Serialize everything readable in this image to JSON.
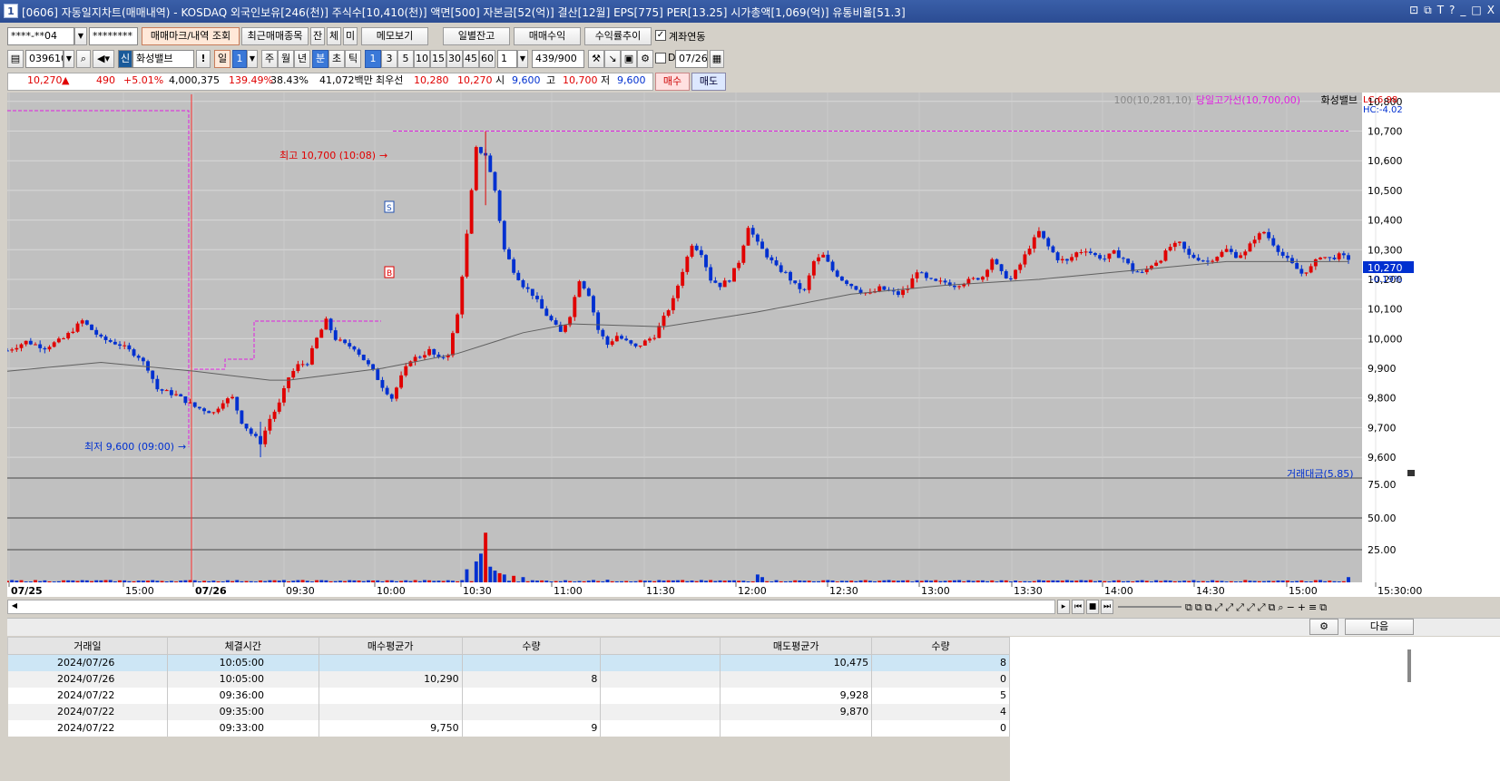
{
  "window": {
    "icon_label": "1",
    "title": "[0606] 자동일지차트(매매내역) - KOSDAQ 외국인보유[246(천)] 주식수[10,410(천)] 액면[500] 자본금[52(억)] 결산[12월] EPS[775] PER[13.25] 시가총액[1,069(억)] 유통비율[51.3]",
    "buttons": [
      "⊡",
      "⧉",
      "T",
      "?",
      "_",
      "□",
      "X"
    ]
  },
  "toolbar1": {
    "account": "****-**04",
    "password": "********",
    "trade_mark_btn": "매매마크/내역 조회",
    "recent_btn": "최근매매종목",
    "tab_jan": "잔",
    "tab_che": "체",
    "tab_mi": "미",
    "memo_btn": "메모보기",
    "daily_balance_btn": "일별잔고",
    "trade_profit_btn": "매매수익",
    "profit_trend_btn": "수익률추이",
    "account_link_label": "계좌연동"
  },
  "toolbar2": {
    "code": "039610",
    "credit": "신",
    "stock_name": "화성밸브",
    "periods": [
      "일",
      "1",
      "주",
      "월",
      "년",
      "분",
      "초",
      "틱"
    ],
    "minutes": [
      "1",
      "3",
      "5",
      "10",
      "15",
      "30",
      "45",
      "60"
    ],
    "unit_value": "1",
    "count": "439",
    "count_total": "/900",
    "d_label": "D",
    "date": "07/26"
  },
  "quote": {
    "price": "10,270",
    "change": "490",
    "change_pct": "+5.01%",
    "volume": "4,000,375",
    "vol_ratio": "139.49%",
    "turnover": "38.43%",
    "amount": "41,072백만",
    "best_label": "최우선",
    "ask": "10,280",
    "bid": "10,270",
    "open_label": "시",
    "open": "9,600",
    "high_label": "고",
    "high": "10,700",
    "low_label": "저",
    "low": "9,600",
    "buy_btn": "매수",
    "sell_btn": "매도"
  },
  "chart_labels": {
    "ma_legend": "100(10,281,10)",
    "high_line_legend": "당일고가선(10,700,00)",
    "stock_legend": "화성밸브",
    "lc": "LC:6.98",
    "hc": "HC:-4.02",
    "current_price": "10,270",
    "current_pct": "-0.19%",
    "max_label": "최고 10,700 (10:08)",
    "min_label": "최저 9,600 (09:00)",
    "volume_legend": "거래대금(5.85)",
    "mark_sell": "S",
    "mark_buy": "B"
  },
  "chart_data": {
    "type": "candlestick",
    "price_axis_ticks": [
      "10,800",
      "10,700",
      "10,600",
      "10,500",
      "10,400",
      "10,300",
      "10,200",
      "10,100",
      "10,000",
      "9,900",
      "9,800",
      "9,700",
      "9,600"
    ],
    "volume_axis_ticks": [
      "75.00",
      "50.00",
      "25.00"
    ],
    "time_axis_ticks": [
      "07/25",
      "15:00",
      "07/26",
      "09:30",
      "10:00",
      "10:30",
      "11:00",
      "11:30",
      "12:00",
      "12:30",
      "13:00",
      "13:30",
      "14:00",
      "14:30",
      "15:00",
      "15:30:00"
    ],
    "ylim": [
      9530,
      10830
    ],
    "high": 10700,
    "low": 9600,
    "close_path": [
      [
        0,
        9960
      ],
      [
        4,
        9990
      ],
      [
        8,
        9970
      ],
      [
        12,
        10000
      ],
      [
        16,
        10060
      ],
      [
        20,
        10000
      ],
      [
        24,
        9980
      ],
      [
        28,
        9940
      ],
      [
        30,
        9900
      ],
      [
        32,
        9830
      ],
      [
        36,
        9810
      ],
      [
        40,
        9770
      ],
      [
        44,
        9750
      ],
      [
        46,
        9790
      ],
      [
        48,
        9800
      ],
      [
        50,
        9720
      ],
      [
        52,
        9680
      ],
      [
        54,
        9650
      ],
      [
        56,
        9730
      ],
      [
        58,
        9780
      ],
      [
        60,
        9870
      ],
      [
        62,
        9910
      ],
      [
        64,
        9920
      ],
      [
        66,
        10000
      ],
      [
        68,
        10060
      ],
      [
        70,
        10000
      ],
      [
        72,
        9980
      ],
      [
        74,
        9970
      ],
      [
        76,
        9930
      ],
      [
        78,
        9890
      ],
      [
        80,
        9840
      ],
      [
        82,
        9800
      ],
      [
        84,
        9870
      ],
      [
        86,
        9930
      ],
      [
        88,
        9940
      ],
      [
        90,
        9960
      ],
      [
        92,
        9930
      ],
      [
        94,
        9950
      ],
      [
        96,
        10080
      ],
      [
        98,
        10350
      ],
      [
        100,
        10640
      ],
      [
        102,
        10620
      ],
      [
        104,
        10500
      ],
      [
        106,
        10300
      ],
      [
        108,
        10230
      ],
      [
        110,
        10180
      ],
      [
        112,
        10150
      ],
      [
        114,
        10100
      ],
      [
        116,
        10060
      ],
      [
        118,
        10020
      ],
      [
        120,
        10080
      ],
      [
        122,
        10200
      ],
      [
        124,
        10150
      ],
      [
        126,
        10030
      ],
      [
        128,
        9980
      ],
      [
        130,
        10010
      ],
      [
        132,
        9990
      ],
      [
        134,
        9970
      ],
      [
        136,
        9990
      ],
      [
        138,
        10010
      ],
      [
        140,
        10070
      ],
      [
        142,
        10130
      ],
      [
        144,
        10230
      ],
      [
        146,
        10320
      ],
      [
        148,
        10290
      ],
      [
        150,
        10200
      ],
      [
        152,
        10180
      ],
      [
        154,
        10200
      ],
      [
        156,
        10260
      ],
      [
        158,
        10380
      ],
      [
        160,
        10320
      ],
      [
        162,
        10280
      ],
      [
        164,
        10240
      ],
      [
        166,
        10220
      ],
      [
        168,
        10180
      ],
      [
        170,
        10160
      ],
      [
        172,
        10260
      ],
      [
        174,
        10280
      ],
      [
        176,
        10230
      ],
      [
        178,
        10200
      ],
      [
        180,
        10180
      ],
      [
        182,
        10160
      ],
      [
        184,
        10150
      ],
      [
        186,
        10170
      ],
      [
        188,
        10160
      ],
      [
        190,
        10150
      ],
      [
        192,
        10170
      ],
      [
        194,
        10230
      ],
      [
        196,
        10200
      ],
      [
        198,
        10190
      ],
      [
        200,
        10190
      ],
      [
        202,
        10180
      ],
      [
        204,
        10190
      ],
      [
        206,
        10200
      ],
      [
        208,
        10210
      ],
      [
        210,
        10270
      ],
      [
        212,
        10220
      ],
      [
        214,
        10200
      ],
      [
        216,
        10250
      ],
      [
        218,
        10310
      ],
      [
        220,
        10360
      ],
      [
        222,
        10310
      ],
      [
        224,
        10270
      ],
      [
        226,
        10260
      ],
      [
        228,
        10290
      ],
      [
        230,
        10300
      ],
      [
        232,
        10280
      ],
      [
        234,
        10270
      ],
      [
        236,
        10290
      ],
      [
        238,
        10270
      ],
      [
        240,
        10230
      ],
      [
        242,
        10220
      ],
      [
        244,
        10250
      ],
      [
        246,
        10270
      ],
      [
        248,
        10310
      ],
      [
        250,
        10320
      ],
      [
        252,
        10280
      ],
      [
        254,
        10270
      ],
      [
        256,
        10260
      ],
      [
        258,
        10280
      ],
      [
        260,
        10300
      ],
      [
        262,
        10280
      ],
      [
        264,
        10290
      ],
      [
        266,
        10340
      ],
      [
        268,
        10360
      ],
      [
        270,
        10320
      ],
      [
        272,
        10280
      ],
      [
        274,
        10250
      ],
      [
        276,
        10220
      ],
      [
        278,
        10240
      ],
      [
        280,
        10280
      ],
      [
        282,
        10270
      ],
      [
        284,
        10280
      ],
      [
        286,
        10270
      ]
    ],
    "ma_path": [
      [
        0,
        9890
      ],
      [
        20,
        9920
      ],
      [
        40,
        9890
      ],
      [
        56,
        9860
      ],
      [
        60,
        9860
      ],
      [
        80,
        9900
      ],
      [
        96,
        9950
      ],
      [
        104,
        9990
      ],
      [
        110,
        10020
      ],
      [
        120,
        10050
      ],
      [
        140,
        10040
      ],
      [
        160,
        10090
      ],
      [
        180,
        10150
      ],
      [
        200,
        10180
      ],
      [
        220,
        10200
      ],
      [
        240,
        10230
      ],
      [
        260,
        10260
      ],
      [
        286,
        10260
      ]
    ],
    "volume_spikes": [
      [
        98,
        10
      ],
      [
        100,
        16
      ],
      [
        101,
        22
      ],
      [
        102,
        38
      ],
      [
        103,
        12
      ],
      [
        104,
        9
      ],
      [
        105,
        7
      ],
      [
        106,
        6
      ],
      [
        108,
        5
      ],
      [
        110,
        4
      ],
      [
        128,
        2
      ],
      [
        160,
        6
      ],
      [
        161,
        4
      ],
      [
        286,
        4
      ]
    ]
  },
  "scrollbar_nav": [
    "▸",
    "⏮",
    "■",
    "⏭"
  ],
  "grid": {
    "settings_icon": "gear-icon",
    "next_btn": "다음",
    "headers": [
      "거래일",
      "체결시간",
      "매수평균가",
      "수량",
      "",
      "매도평균가",
      "수량"
    ],
    "rows": [
      [
        "2024/07/26",
        "10:05:00",
        "",
        "",
        "",
        "10,475",
        "8"
      ],
      [
        "2024/07/26",
        "10:05:00",
        "10,290",
        "8",
        "",
        "",
        "0"
      ],
      [
        "2024/07/22",
        "09:36:00",
        "",
        "",
        "",
        "9,928",
        "5"
      ],
      [
        "2024/07/22",
        "09:35:00",
        "",
        "",
        "",
        "9,870",
        "4"
      ],
      [
        "2024/07/22",
        "09:33:00",
        "9,750",
        "9",
        "",
        "",
        "0"
      ]
    ]
  },
  "colors": {
    "up": "#e00000",
    "down": "#0030d0",
    "chart_bg": "#c0c0c0",
    "high_line": "#e020e0",
    "ma": "#606060"
  }
}
